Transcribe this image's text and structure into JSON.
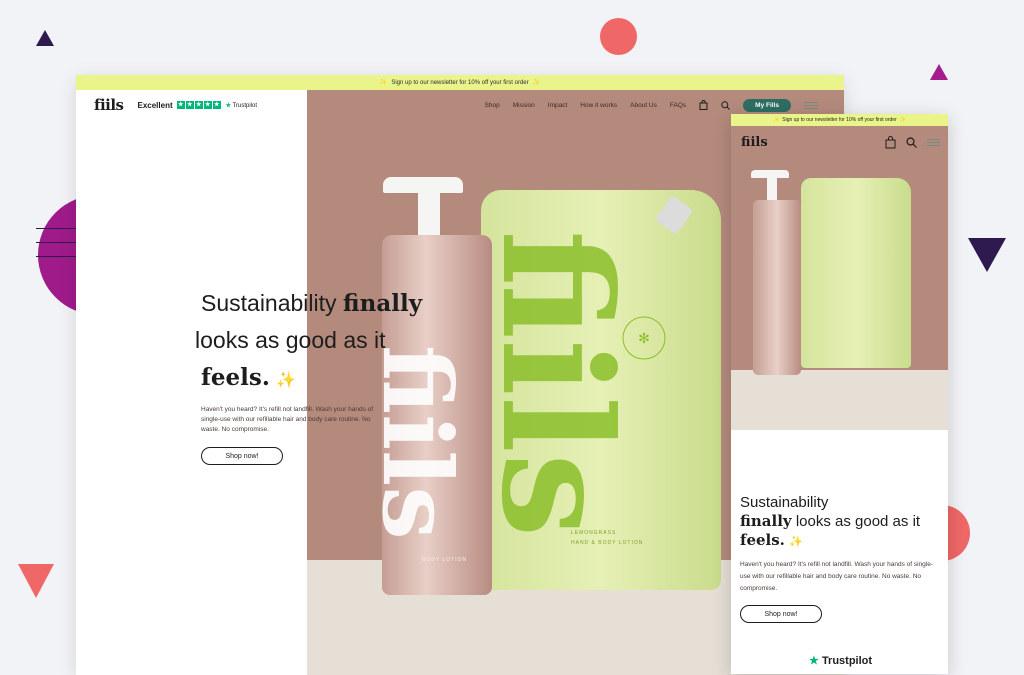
{
  "banner": {
    "text": "Sign up to our newsletter for 10% off your first order"
  },
  "brand": {
    "logo": "fiils"
  },
  "trustpilot": {
    "rating_label": "Excellent",
    "brand": "Trustpilot",
    "mobile_brand": "Trustpilot"
  },
  "nav": {
    "items": [
      "Shop",
      "Mission",
      "Impact",
      "How it works",
      "About Us",
      "FAQs"
    ],
    "cta": "My Fills"
  },
  "hero": {
    "headline_pre": "Sustainability ",
    "headline_bold1": "finally",
    "headline_mid": " looks as good as it",
    "headline_bold2": "feels.",
    "sparkle": "✨",
    "body": "Haven't you heard? It's refill not landfill. Wash your hands of single-use with our refillable hair and body care routine. No waste. No compromise.",
    "button": "Shop now!"
  },
  "product": {
    "pouch_label_1": "LEMONGRASS",
    "pouch_label_2": "HAND & BODY LOTION",
    "bottle_label": "BODY LOTION"
  },
  "mobile": {
    "headline_pre": "Sustainability",
    "headline_bold1": "finally",
    "headline_mid": " looks as good as it ",
    "headline_bold2": "feels.",
    "sparkle": "✨",
    "body": "Haven't you heard? It's refill not landfill. Wash your hands of single-use with our refillable hair and body care routine. No waste. No compromise.",
    "button": "Shop now!"
  },
  "colors": {
    "accent": "#2e6e62",
    "banner": "#e9f58a",
    "hero_bg": "#b48a7d",
    "trustpilot": "#00b67a"
  },
  "icons": [
    "bag-icon",
    "search-icon",
    "menu-icon",
    "star-icon",
    "sparkle-icon"
  ]
}
